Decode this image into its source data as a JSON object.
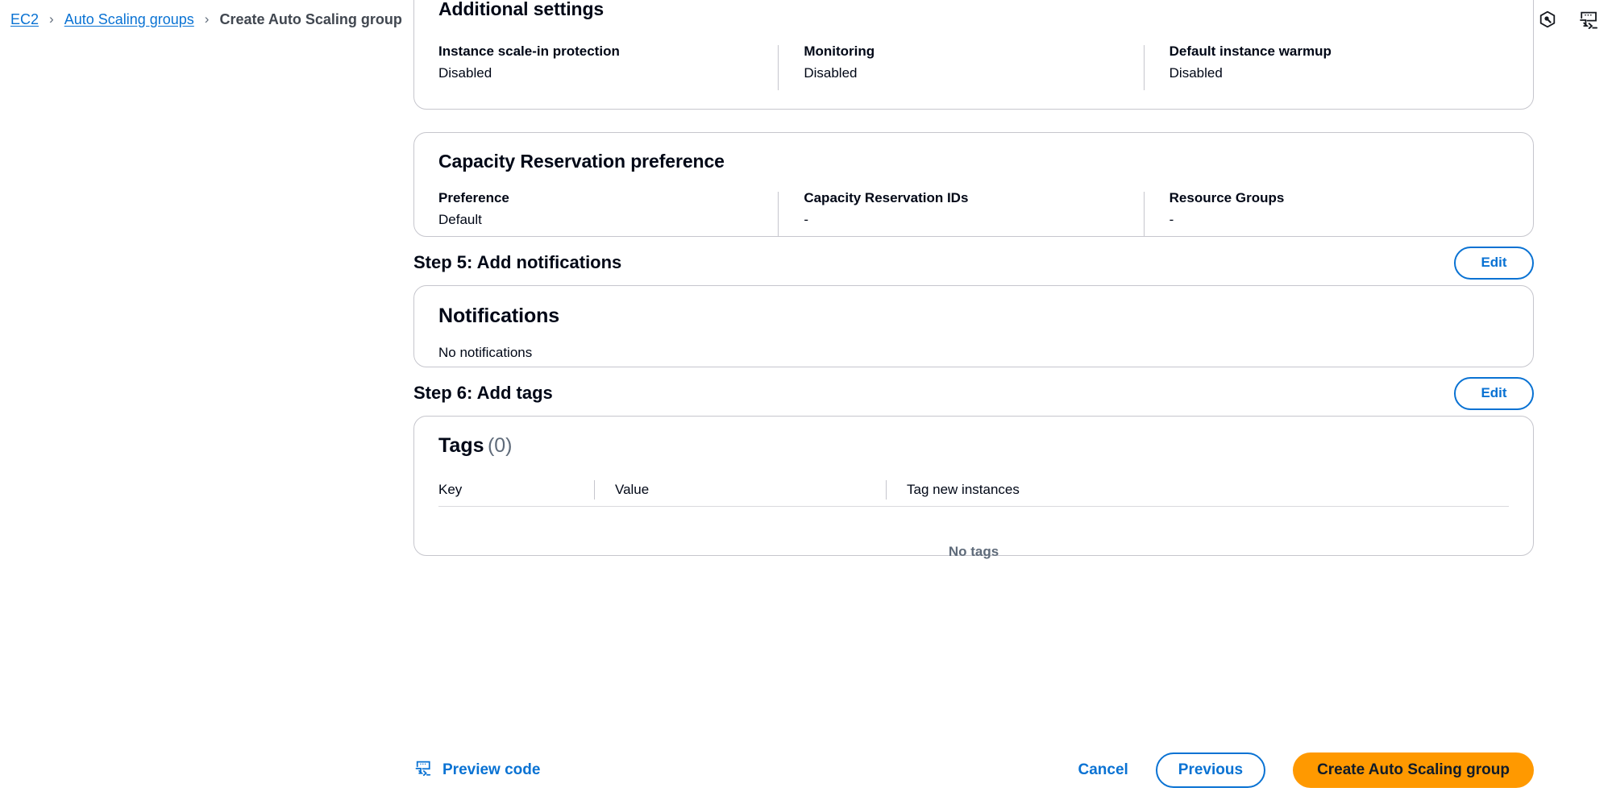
{
  "breadcrumb": {
    "items": [
      {
        "label": "EC2",
        "current": false
      },
      {
        "label": "Auto Scaling groups",
        "current": false
      },
      {
        "label": "Create Auto Scaling group",
        "current": true
      }
    ],
    "separator": "›"
  },
  "top_icons": [
    {
      "name": "info-icon",
      "title": "Info"
    },
    {
      "name": "settings-hexagon-icon",
      "title": "Settings"
    },
    {
      "name": "cloudshell-terminal-icon",
      "title": "CloudShell"
    }
  ],
  "additional_settings": {
    "title": "Additional settings",
    "fields": [
      {
        "label": "Instance scale-in protection",
        "value": "Disabled"
      },
      {
        "label": "Monitoring",
        "value": "Disabled"
      },
      {
        "label": "Default instance warmup",
        "value": "Disabled"
      }
    ]
  },
  "capacity_reservation": {
    "title": "Capacity Reservation preference",
    "fields": [
      {
        "label": "Preference",
        "value": "Default"
      },
      {
        "label": "Capacity Reservation IDs",
        "value": "-"
      },
      {
        "label": "Resource Groups",
        "value": "-"
      }
    ]
  },
  "step5": {
    "title": "Step 5: Add notifications",
    "edit_label": "Edit",
    "card_title": "Notifications",
    "empty_text": "No notifications"
  },
  "step6": {
    "title": "Step 6: Add tags",
    "edit_label": "Edit",
    "card_title": "Tags",
    "card_count": "(0)",
    "columns": [
      "Key",
      "Value",
      "Tag new instances"
    ],
    "empty_text": "No tags"
  },
  "footer": {
    "preview_code": "Preview code",
    "cancel": "Cancel",
    "previous": "Previous",
    "create": "Create Auto Scaling group"
  },
  "colors": {
    "link": "#0972d3",
    "accent_orange": "#ff9900",
    "text": "#000716",
    "muted": "#5f6b7a",
    "border": "#c6c6cd"
  }
}
